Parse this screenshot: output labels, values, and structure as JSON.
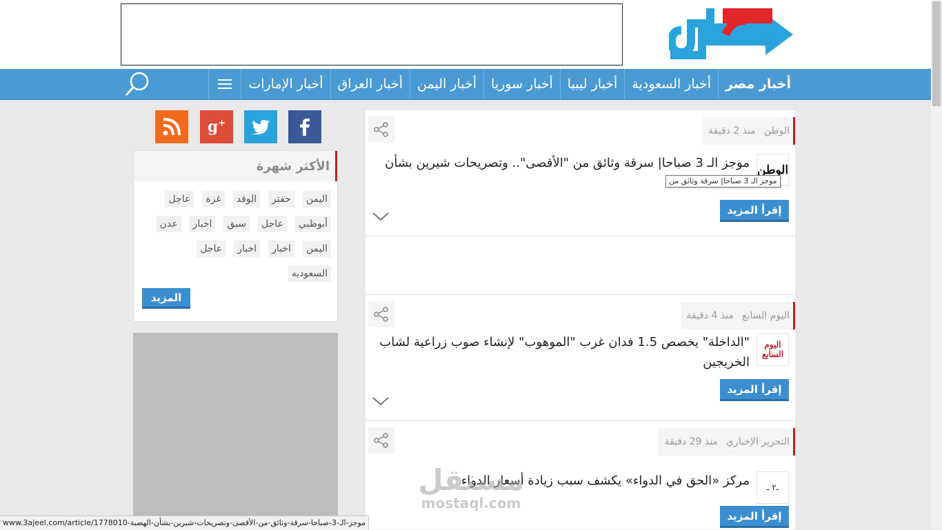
{
  "header": {
    "logo_text": "3ajeel",
    "logo_alt": "عاجل"
  },
  "nav": {
    "items": [
      {
        "label": "أخبار مصر",
        "active": true
      },
      {
        "label": "أخبار السعودية"
      },
      {
        "label": "أخبار ليبيا"
      },
      {
        "label": "أخبار سوريا"
      },
      {
        "label": "أخبار اليمن"
      },
      {
        "label": "أخبار العراق"
      },
      {
        "label": "أخبار الإمارات"
      }
    ],
    "menu_icon": "hamburger-icon",
    "search_icon": "search-icon"
  },
  "social": [
    "facebook-icon",
    "twitter-icon",
    "google-plus-icon",
    "rss-icon"
  ],
  "popular": {
    "title": "الأكثر شهرة",
    "tags": [
      "اليمن",
      "حفتر",
      "الوفد",
      "غزة",
      "عاجل",
      "أبوظبي",
      "عاجل",
      "سبق",
      "اخبار",
      "عدن",
      "اليمن",
      "اخبار",
      "اخبار",
      "عاجل",
      "السعوديه"
    ],
    "more_label": "المزيد"
  },
  "articles": [
    {
      "source": "الوطن",
      "time": "منذ 2 دقيقة",
      "headline": "موجز الـ 3 صباحا| سرقة وثائق من \"الأقصى\".. وتصريحات شيرين بشأن",
      "thumb_text": "الوطن",
      "read_more": "إقرأ المزيد"
    },
    {
      "source": "اليوم السابع",
      "time": "منذ 4 دقيقة",
      "headline": "\"الداخلة\" يخصص 1.5 فدان غرب \"الموهوب\" لإنشاء صوب زراعية لشاب الخريجين",
      "thumb_text": "اليوم السابع",
      "read_more": "إقرأ المزيد"
    },
    {
      "source": "التحرير الإخباري",
      "time": "منذ 29 دقيقة",
      "headline": "مركز «الحق في الدواء» يكشف سبب زيادة أسعار الدواء",
      "thumb_text": "ـ٢ ـ",
      "read_more": "إقرأ المزيد"
    }
  ],
  "tooltip": "موجز الـ 3 صباحا| سرقة وثائق من",
  "watermark": {
    "ar": "مستقل",
    "en": "mostaql.com"
  },
  "status_url": "www.3ajeel.com/article/1778010-موجز-الـ-3-صباحا-سرقة-وثائق-من-الأقصى-وتصريحات-شيرين-بشأن-الهضبة",
  "colors": {
    "nav": "#4a9ad4",
    "accent": "#c32026",
    "button": "#3b8fd0"
  }
}
